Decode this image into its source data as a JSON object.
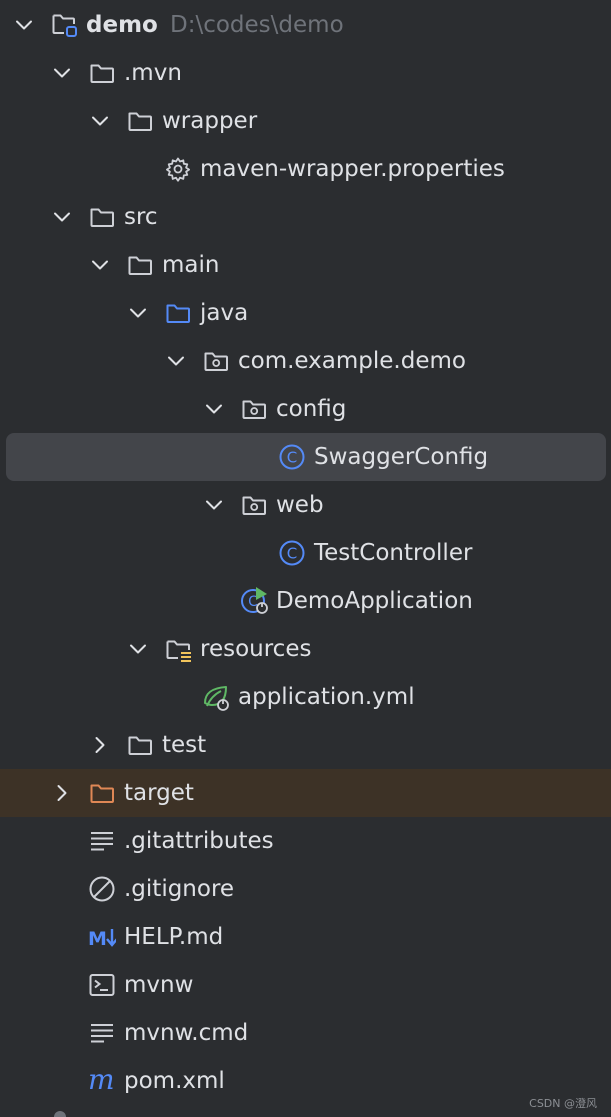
{
  "project": {
    "name": "demo",
    "path": "D:\\codes\\demo"
  },
  "rows": [
    {
      "name": "row-demo",
      "label": "demo",
      "path": "D:\\codes\\demo",
      "depth": 0,
      "arrow": "down",
      "icon": "module-folder-icon",
      "root": true
    },
    {
      "name": "row-mvn",
      "label": ".mvn",
      "depth": 1,
      "arrow": "down",
      "icon": "folder-icon"
    },
    {
      "name": "row-wrapper",
      "label": "wrapper",
      "depth": 2,
      "arrow": "down",
      "icon": "folder-icon"
    },
    {
      "name": "row-maven-wrapper-properties",
      "label": "maven-wrapper.properties",
      "depth": 3,
      "arrow": "",
      "icon": "gear-icon"
    },
    {
      "name": "row-src",
      "label": "src",
      "depth": 1,
      "arrow": "down",
      "icon": "folder-icon"
    },
    {
      "name": "row-main",
      "label": "main",
      "depth": 2,
      "arrow": "down",
      "icon": "folder-icon"
    },
    {
      "name": "row-java",
      "label": "java",
      "depth": 3,
      "arrow": "down",
      "icon": "source-folder-icon"
    },
    {
      "name": "row-com-example-demo",
      "label": "com.example.demo",
      "depth": 4,
      "arrow": "down",
      "icon": "package-icon"
    },
    {
      "name": "row-config",
      "label": "config",
      "depth": 5,
      "arrow": "down",
      "icon": "package-icon"
    },
    {
      "name": "row-swaggerconfig",
      "label": "SwaggerConfig",
      "depth": 6,
      "arrow": "",
      "icon": "class-icon",
      "selected": true
    },
    {
      "name": "row-web",
      "label": "web",
      "depth": 5,
      "arrow": "down",
      "icon": "package-icon"
    },
    {
      "name": "row-testcontroller",
      "label": "TestController",
      "depth": 6,
      "arrow": "",
      "icon": "class-icon"
    },
    {
      "name": "row-demoapplication",
      "label": "DemoApplication",
      "depth": 5,
      "arrow": "",
      "icon": "spring-boot-app-icon"
    },
    {
      "name": "row-resources",
      "label": "resources",
      "depth": 3,
      "arrow": "down",
      "icon": "resources-folder-icon"
    },
    {
      "name": "row-application-yml",
      "label": "application.yml",
      "depth": 4,
      "arrow": "",
      "icon": "spring-config-icon"
    },
    {
      "name": "row-test",
      "label": "test",
      "depth": 2,
      "arrow": "right",
      "icon": "folder-icon"
    },
    {
      "name": "row-target",
      "label": "target",
      "depth": 1,
      "arrow": "right",
      "icon": "excluded-folder-icon",
      "excluded": true
    },
    {
      "name": "row-gitattributes",
      "label": ".gitattributes",
      "depth": 1,
      "arrow": "",
      "icon": "text-file-icon"
    },
    {
      "name": "row-gitignore",
      "label": ".gitignore",
      "depth": 1,
      "arrow": "",
      "icon": "ignore-file-icon"
    },
    {
      "name": "row-help-md",
      "label": "HELP.md",
      "depth": 1,
      "arrow": "",
      "icon": "markdown-icon"
    },
    {
      "name": "row-mvnw",
      "label": "mvnw",
      "depth": 1,
      "arrow": "",
      "icon": "shell-script-icon"
    },
    {
      "name": "row-mvnw-cmd",
      "label": "mvnw.cmd",
      "depth": 1,
      "arrow": "",
      "icon": "text-file-icon"
    },
    {
      "name": "row-pom-xml",
      "label": "pom.xml",
      "depth": 1,
      "arrow": "",
      "icon": "maven-icon"
    }
  ],
  "colors": {
    "background": "#2b2d30",
    "selection": "#43454a",
    "excluded_row": "#3d3226",
    "text": "#dfe1e5",
    "muted_text": "#6f737a",
    "folder_stroke": "#ced0d6",
    "source_folder": "#548af7",
    "class_icon": "#548af7",
    "excluded_folder": "#e08855",
    "spring_green": "#5fb865"
  },
  "watermark": "CSDN @澄风"
}
